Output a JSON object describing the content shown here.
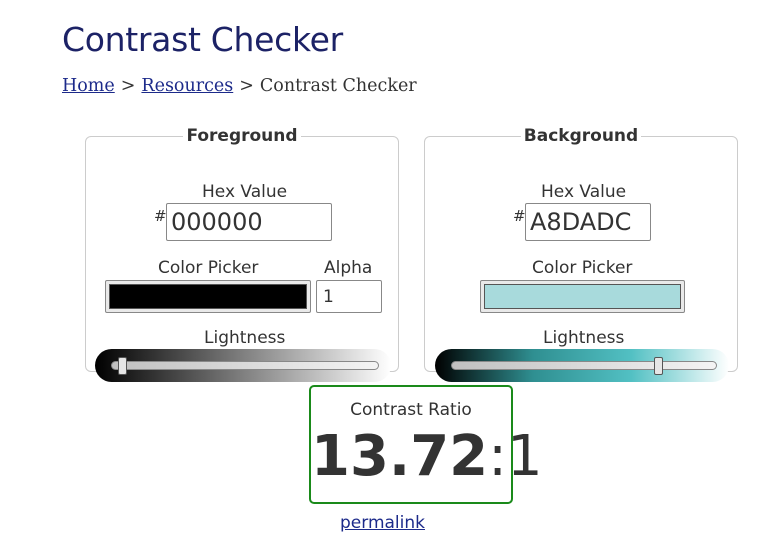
{
  "page": {
    "title": "Contrast Checker"
  },
  "breadcrumb": {
    "items": [
      "Home",
      "Resources",
      "Contrast Checker"
    ],
    "separator": ">"
  },
  "foreground": {
    "legend": "Foreground",
    "hex_label": "Hex Value",
    "hash": "#",
    "hex_value": "000000",
    "picker_label": "Color Picker",
    "picker_color": "#000000",
    "alpha_label": "Alpha",
    "alpha_value": "1",
    "lightness_label": "Lightness",
    "lightness_level": 0.04,
    "slider_gradient": [
      "#000000",
      "#ffffff"
    ]
  },
  "background": {
    "legend": "Background",
    "hex_label": "Hex Value",
    "hash": "#",
    "hex_value": "A8DADC",
    "picker_label": "Color Picker",
    "picker_color": "#A8DADC",
    "lightness_label": "Lightness",
    "lightness_level": 0.78,
    "slider_gradient": [
      "#000000",
      "#2f8f91",
      "#52c0c3",
      "#ffffff"
    ]
  },
  "contrast": {
    "label": "Contrast Ratio",
    "ratio": "13.72",
    "suffix": ":1",
    "border_color": "#1a8a1a"
  },
  "permalink": {
    "label": "permalink"
  },
  "colors": {
    "title": "#1c2266",
    "link": "#1c2a8a",
    "text": "#333333"
  }
}
